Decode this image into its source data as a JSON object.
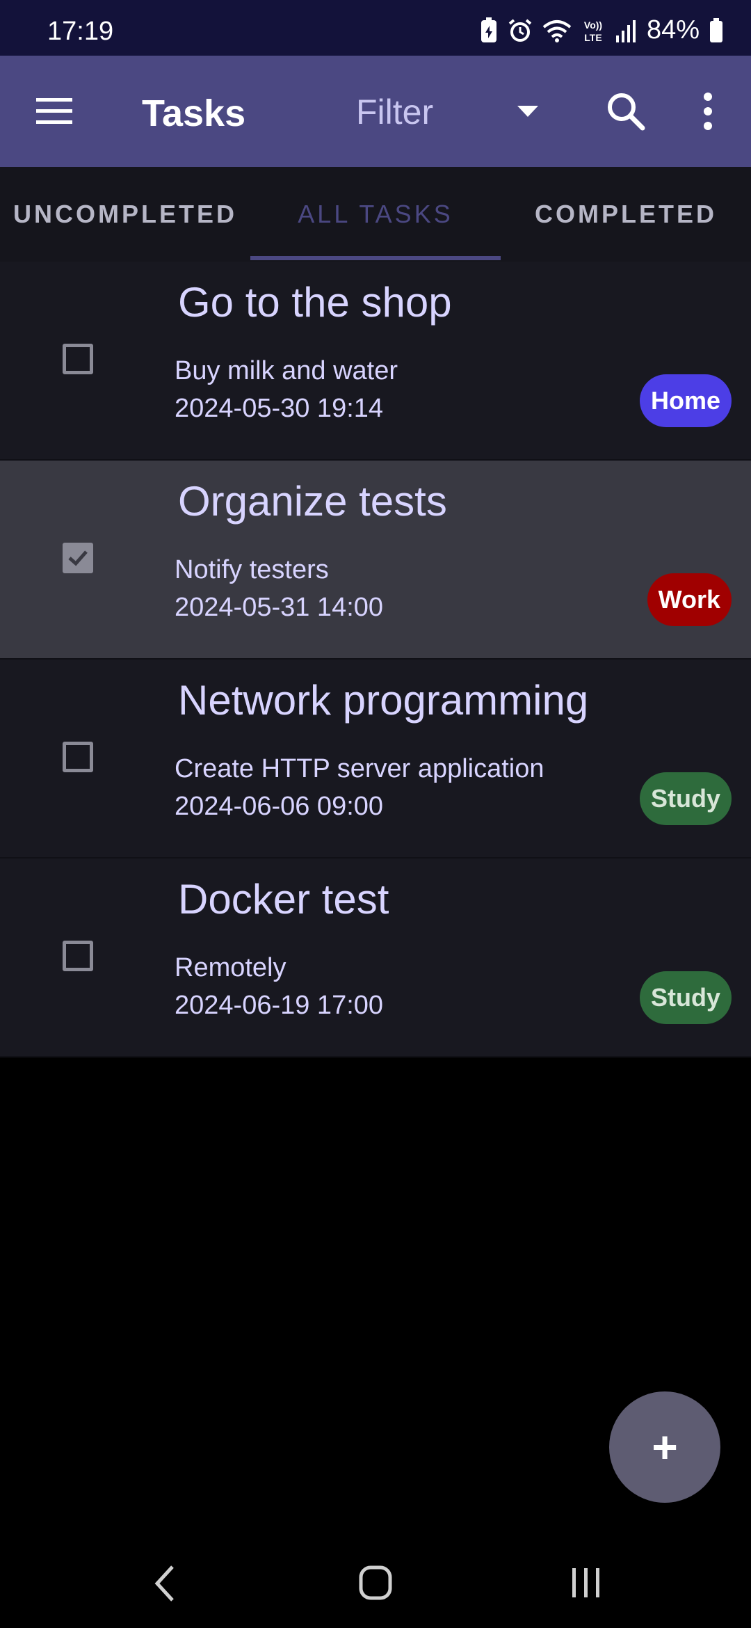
{
  "status_bar": {
    "time": "17:19",
    "battery": "84%",
    "icons": [
      "battery-saver-icon",
      "alarm-icon",
      "wifi-icon",
      "volte-icon",
      "signal-icon",
      "battery-icon"
    ]
  },
  "app_bar": {
    "title": "Tasks",
    "filter_label": "Filter",
    "icons": [
      "menu-icon",
      "dropdown-icon",
      "search-icon",
      "more-vert-icon"
    ]
  },
  "tabs": [
    {
      "label": "UNCOMPLETED",
      "active": false
    },
    {
      "label": "ALL TASKS",
      "active": true
    },
    {
      "label": "COMPLETED",
      "active": false
    }
  ],
  "tasks": [
    {
      "title": "Go to the shop",
      "description": "Buy milk and water",
      "datetime": "2024-05-30 19:14",
      "tag": "Home",
      "tag_color": "#4c3ee6",
      "completed": false,
      "selected": false
    },
    {
      "title": "Organize tests",
      "description": "Notify testers",
      "datetime": "2024-05-31 14:00",
      "tag": "Work",
      "tag_color": "#a00000",
      "completed": true,
      "selected": true
    },
    {
      "title": "Network programming",
      "description": "Create HTTP server application",
      "datetime": "2024-06-06 09:00",
      "tag": "Study",
      "tag_color": "#2e6b3c",
      "completed": false,
      "selected": false
    },
    {
      "title": "Docker test",
      "description": "Remotely",
      "datetime": "2024-06-19 17:00",
      "tag": "Study",
      "tag_color": "#2e6b3c",
      "completed": false,
      "selected": false
    }
  ],
  "fab": {
    "label": "+"
  },
  "colors": {
    "app_bar": "#4b4882",
    "status_bar": "#13123a",
    "list_bg": "#181820",
    "selected_bg": "#393942",
    "text": "#d8d4ff"
  }
}
